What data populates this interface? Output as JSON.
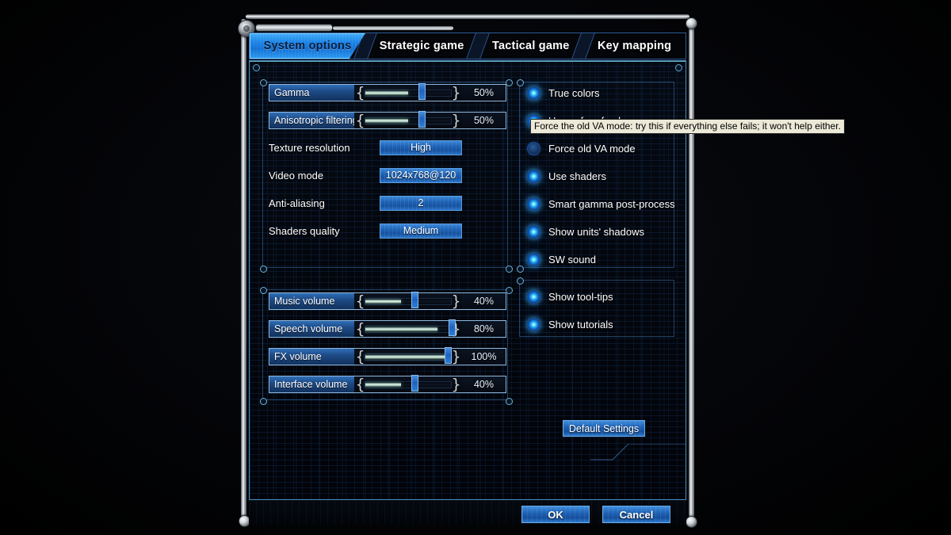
{
  "window": {
    "tabs": [
      {
        "label": "System options",
        "active": true
      },
      {
        "label": "Strategic game",
        "active": false
      },
      {
        "label": "Tactical game",
        "active": false
      },
      {
        "label": "Key mapping",
        "active": false
      }
    ]
  },
  "video_group": {
    "sliders": [
      {
        "name": "gamma",
        "label": "Gamma",
        "value": 50,
        "value_text": "50%"
      },
      {
        "name": "anisotropic-filtering",
        "label": "Anisotropic filtering",
        "value": 50,
        "value_text": "50%"
      }
    ],
    "dropdowns": [
      {
        "name": "texture-resolution",
        "label": "Texture resolution",
        "value": "High"
      },
      {
        "name": "video-mode",
        "label": "Video mode",
        "value": "1024x768@120"
      },
      {
        "name": "anti-aliasing",
        "label": "Anti-aliasing",
        "value": "2"
      },
      {
        "name": "shaders-quality",
        "label": "Shaders quality",
        "value": "Medium"
      }
    ]
  },
  "audio_group": {
    "sliders": [
      {
        "name": "music-volume",
        "label": "Music volume",
        "value": 40,
        "value_text": "40%"
      },
      {
        "name": "speech-volume",
        "label": "Speech volume",
        "value": 80,
        "value_text": "80%"
      },
      {
        "name": "fx-volume",
        "label": "FX volume",
        "value": 100,
        "value_text": "100%"
      },
      {
        "name": "interface-volume",
        "label": "Interface volume",
        "value": 40,
        "value_text": "40%"
      }
    ]
  },
  "render_options": {
    "checkboxes": [
      {
        "name": "true-colors",
        "label": "True colors",
        "checked": true
      },
      {
        "name": "use-safe-refresh",
        "label": "Use safe refresh",
        "checked": true
      },
      {
        "name": "force-old-va-mode",
        "label": "Force old VA mode",
        "checked": false
      },
      {
        "name": "use-shaders",
        "label": "Use shaders",
        "checked": true
      },
      {
        "name": "smart-gamma-post-process",
        "label": "Smart gamma post-process",
        "checked": true
      },
      {
        "name": "show-units-shadows",
        "label": "Show units' shadows",
        "checked": true
      },
      {
        "name": "sw-sound",
        "label": "SW sound",
        "checked": true
      }
    ]
  },
  "help_options": {
    "checkboxes": [
      {
        "name": "show-tool-tips",
        "label": "Show tool-tips",
        "checked": true
      },
      {
        "name": "show-tutorials",
        "label": "Show tutorials",
        "checked": true
      }
    ]
  },
  "tooltip": {
    "text": "Force the old VA mode: try this if everything else fails; it won't help either."
  },
  "buttons": {
    "default_settings": "Default Settings",
    "ok": "OK",
    "cancel": "Cancel"
  },
  "colors": {
    "accent_cyan": "#3fa9f5",
    "panel_border": "#4a8fbf",
    "slider_fill": "#eaf6ef",
    "checkbox_on": "#22a9ee",
    "tooltip_bg": "#ece9d8"
  }
}
